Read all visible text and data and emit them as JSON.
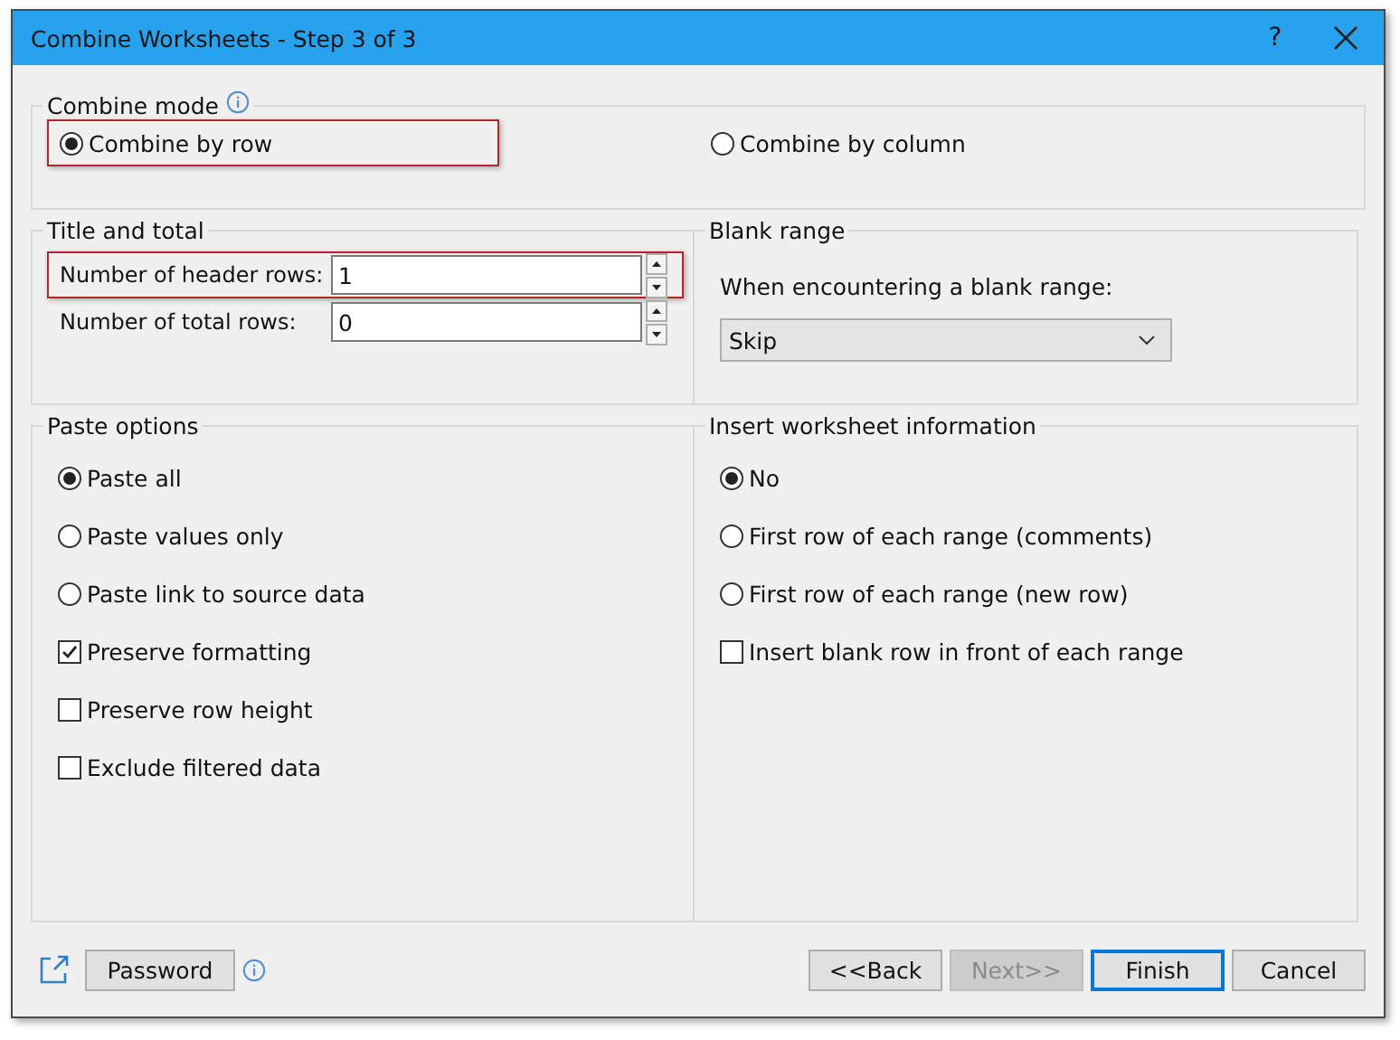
{
  "window": {
    "title": "Combine Worksheets - Step 3 of 3",
    "help": "?"
  },
  "combine_mode": {
    "label": "Combine mode",
    "options": [
      {
        "label": "Combine by row",
        "selected": true,
        "highlighted": true
      },
      {
        "label": "Combine by column",
        "selected": false,
        "highlighted": false
      }
    ]
  },
  "title_and_total": {
    "label": "Title and total",
    "fields": [
      {
        "label": "Number of header rows:",
        "value": "1",
        "highlighted": true
      },
      {
        "label": "Number of total rows:",
        "value": "0",
        "highlighted": false
      }
    ]
  },
  "blank_range": {
    "label": "Blank range",
    "prompt": "When encountering a blank range:",
    "value": "Skip"
  },
  "paste_options": {
    "label": "Paste options",
    "items": [
      {
        "kind": "radio",
        "label": "Paste all",
        "selected": true
      },
      {
        "kind": "radio",
        "label": "Paste values only",
        "selected": false
      },
      {
        "kind": "radio",
        "label": "Paste link to source data",
        "selected": false
      },
      {
        "kind": "checkbox",
        "label": "Preserve formatting",
        "checked": true
      },
      {
        "kind": "checkbox",
        "label": "Preserve row height",
        "checked": false
      },
      {
        "kind": "checkbox",
        "label": "Exclude filtered data",
        "checked": false
      }
    ]
  },
  "insert_info": {
    "label": "Insert worksheet information",
    "items": [
      {
        "kind": "radio",
        "label": "No",
        "selected": true
      },
      {
        "kind": "radio",
        "label": "First row of each range (comments)",
        "selected": false
      },
      {
        "kind": "radio",
        "label": "First row of each range (new row)",
        "selected": false
      },
      {
        "kind": "checkbox",
        "label": "Insert blank row in front of each range",
        "checked": false
      }
    ]
  },
  "footer": {
    "password": "Password",
    "buttons": [
      {
        "label": "<<Back",
        "disabled": false,
        "default": false
      },
      {
        "label": "Next>>",
        "disabled": true,
        "default": false
      },
      {
        "label": "Finish",
        "disabled": false,
        "default": true
      },
      {
        "label": "Cancel",
        "disabled": false,
        "default": false
      }
    ]
  }
}
